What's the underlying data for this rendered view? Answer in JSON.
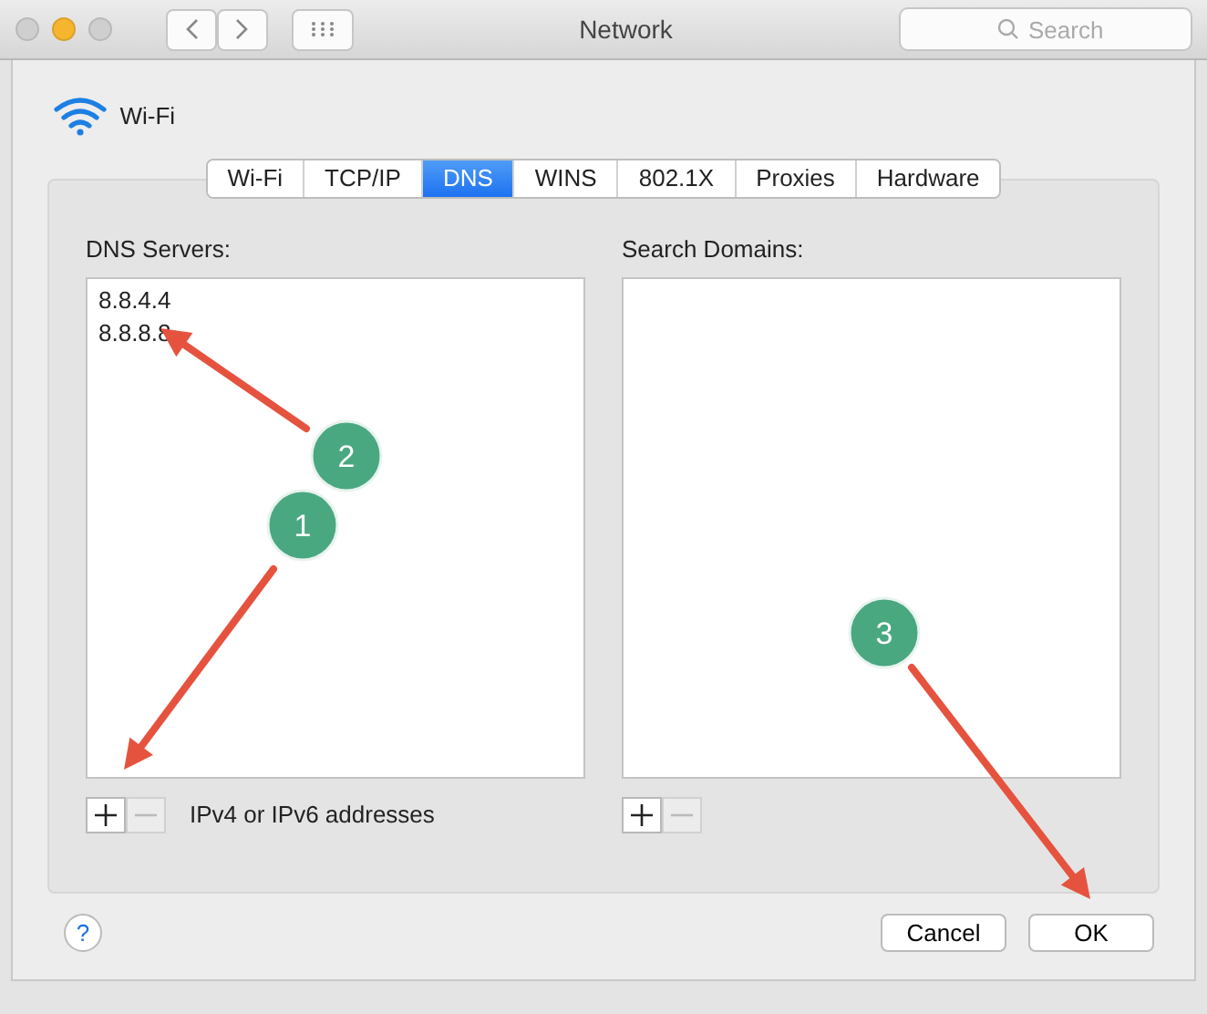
{
  "window": {
    "title": "Network",
    "search": {
      "placeholder": "Search"
    }
  },
  "interface": {
    "name": "Wi-Fi"
  },
  "tabs": [
    {
      "label": "Wi-Fi",
      "selected": false
    },
    {
      "label": "TCP/IP",
      "selected": false
    },
    {
      "label": "DNS",
      "selected": true
    },
    {
      "label": "WINS",
      "selected": false
    },
    {
      "label": "802.1X",
      "selected": false
    },
    {
      "label": "Proxies",
      "selected": false
    },
    {
      "label": "Hardware",
      "selected": false
    }
  ],
  "dns_servers": {
    "label": "DNS Servers:",
    "items": [
      "8.8.4.4",
      "8.8.8.8"
    ],
    "hint": "IPv4 or IPv6 addresses"
  },
  "search_domains": {
    "label": "Search Domains:"
  },
  "buttons": {
    "help": "?",
    "cancel": "Cancel",
    "ok": "OK"
  },
  "annotations": [
    {
      "label": "2"
    },
    {
      "label": "1"
    },
    {
      "label": "3"
    }
  ]
}
